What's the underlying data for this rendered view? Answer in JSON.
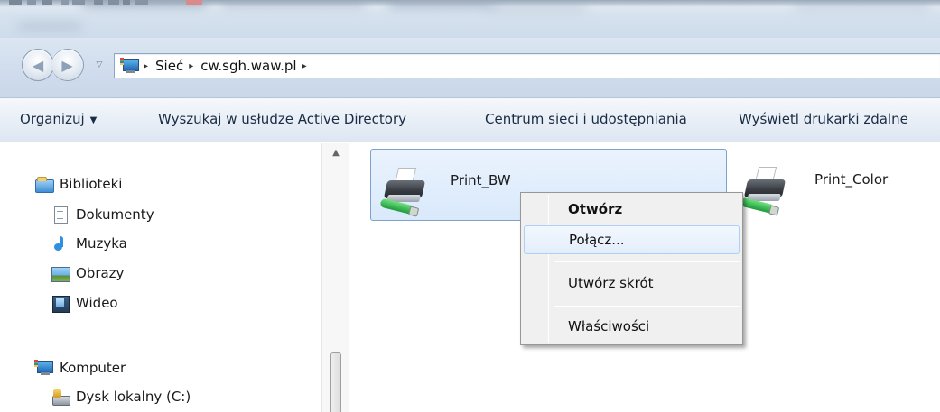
{
  "window": {
    "title_strip": ""
  },
  "navigation": {
    "back_symbol": "◀",
    "forward_symbol": "▶",
    "history_symbol": "▽",
    "crumb_separator": "▸",
    "breadcrumbs": [
      "Sieć",
      "cw.sgh.waw.pl"
    ]
  },
  "command_bar": {
    "items": [
      {
        "label": "Organizuj",
        "caret": "▼"
      },
      {
        "label": "Wyszukaj w usłudze Active Directory"
      },
      {
        "label": "Centrum sieci i udostępniania"
      },
      {
        "label": "Wyświetl drukarki zdalne"
      }
    ]
  },
  "sidebar": {
    "libraries_label": "Biblioteki",
    "library_items": [
      "Dokumenty",
      "Muzyka",
      "Obrazy",
      "Wideo"
    ],
    "computer_label": "Komputer",
    "computer_items": [
      "Dysk lokalny (C:)"
    ],
    "scroll_up_symbol": "▲"
  },
  "content": {
    "items": [
      {
        "name": "Print_BW",
        "selected": true
      },
      {
        "name": "Print_Color",
        "selected": false
      }
    ]
  },
  "context_menu": {
    "items": [
      {
        "label": "Otwórz",
        "default": true
      },
      {
        "label": "Połącz...",
        "highlighted": true
      },
      {
        "label": "Utwórz skrót"
      },
      {
        "label": "Właściwości"
      }
    ]
  },
  "colors": {
    "selection_fill": "#d9e9fb",
    "selection_border": "#7da2ce",
    "menu_hover_border": "#aecff7"
  }
}
